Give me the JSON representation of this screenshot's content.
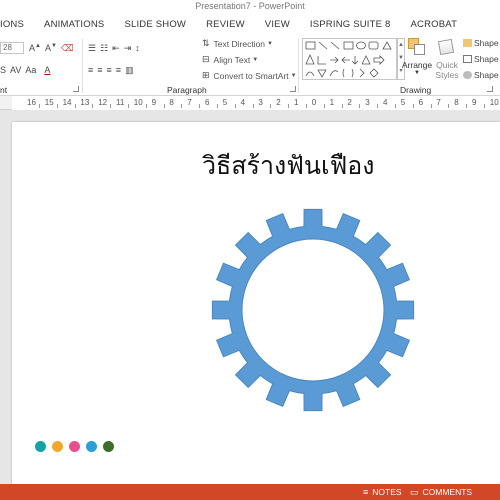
{
  "window": {
    "title": "Presentation7 - PowerPoint"
  },
  "tabs": [
    "TIONS",
    "ANIMATIONS",
    "SLIDE SHOW",
    "REVIEW",
    "VIEW",
    "ISPRING SUITE 8",
    "ACROBAT"
  ],
  "ribbon": {
    "font_size_value": "28",
    "text_direction_label": "Text Direction",
    "align_text_label": "Align Text",
    "convert_smartart_label": "Convert to SmartArt",
    "arrange_label": "Arrange",
    "quick_styles_label": "Quick Styles",
    "quick_styles_line1": "Quick",
    "quick_styles_line2": "Styles",
    "shape_fill_label": "Shape",
    "shape_outline_label": "Shape",
    "shape_effects_label": "Shape",
    "groups": {
      "font": "nt",
      "paragraph": "Paragraph",
      "drawing": "Drawing"
    }
  },
  "ruler": {
    "labels": [
      "16",
      "15",
      "14",
      "13",
      "12",
      "11",
      "10",
      "9",
      "8",
      "7",
      "6",
      "5",
      "4",
      "3",
      "2",
      "1",
      "0",
      "1",
      "2",
      "3",
      "4",
      "5",
      "6",
      "7",
      "8",
      "9",
      "10"
    ]
  },
  "slide": {
    "title": "วิธีสร้างฟันเฟือง",
    "gear_color": "#5b9bd5",
    "gear_stroke": "#4a86c0",
    "dot_colors": [
      "#12a3a3",
      "#f0a82a",
      "#e84f8c",
      "#2b9fd6",
      "#3b6e2b"
    ]
  },
  "statusbar": {
    "notes_label": "NOTES",
    "comments_label": "COMMENTS",
    "color": "#d24726"
  }
}
